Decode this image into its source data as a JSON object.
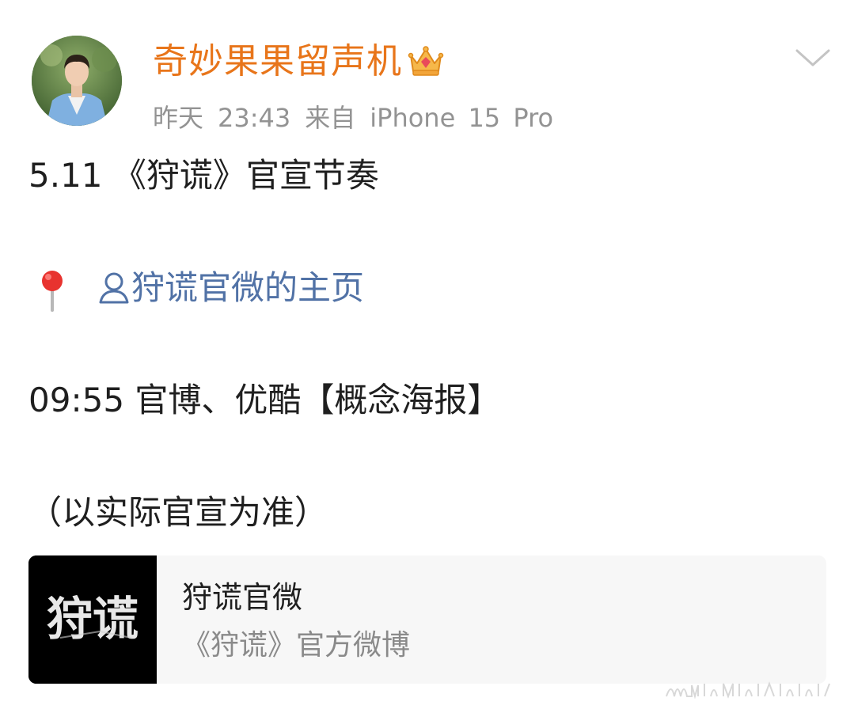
{
  "post": {
    "author": "奇妙果果留声机",
    "date": "昨天",
    "time": "23:43",
    "source_prefix": "来自",
    "device": "iPhone 15 Pro"
  },
  "content": {
    "line1": "5.11 《狩谎》官宣节奏",
    "profile_link": "狩谎官微的主页",
    "line3": "09:55 官博、优酷【概念海报】",
    "line4": "（以实际官宣为准）"
  },
  "card": {
    "title": "狩谎官微",
    "subtitle": "《狩谎》官方微博",
    "logo_text": "狩谎"
  },
  "colors": {
    "username": "#e8751a",
    "link": "#5172a6",
    "meta": "#939393",
    "text": "#1f1f1f"
  },
  "icons": {
    "badge": "crown-icon",
    "menu": "chevron-down-icon",
    "location": "pin-icon",
    "profile": "user-icon"
  }
}
